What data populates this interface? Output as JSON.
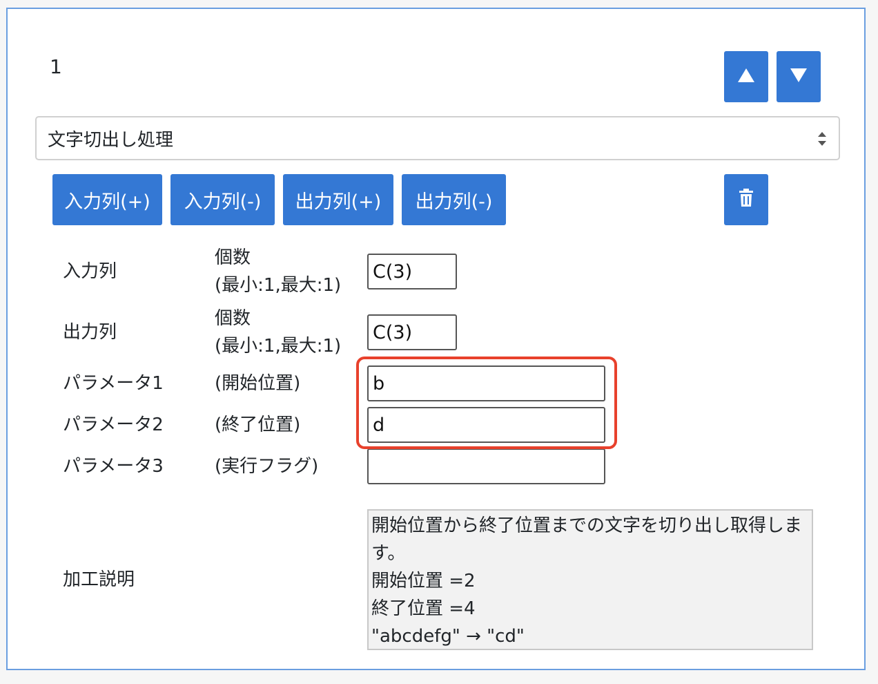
{
  "step": {
    "number": "1"
  },
  "move_buttons": {
    "up": "▲",
    "down": "▼"
  },
  "select": {
    "value": "文字切出し処理"
  },
  "toolbar": {
    "input_add": "入力列(+)",
    "input_remove": "入力列(-)",
    "output_add": "出力列(+)",
    "output_remove": "出力列(-)"
  },
  "rows": {
    "input": {
      "label": "入力列",
      "hint_line1": "個数",
      "hint_line2": "(最小:1,最大:1)",
      "value": "C(3)"
    },
    "output": {
      "label": "出力列",
      "hint_line1": "個数",
      "hint_line2": "(最小:1,最大:1)",
      "value": "C(3)"
    },
    "param1": {
      "label": "パラメータ1",
      "hint": "(開始位置)",
      "value": "b"
    },
    "param2": {
      "label": "パラメータ2",
      "hint": "(終了位置)",
      "value": "d"
    },
    "param3": {
      "label": "パラメータ3",
      "hint": "(実行フラグ)",
      "value": ""
    }
  },
  "description": {
    "label": "加工説明",
    "lines": [
      "開始位置から終了位置までの文字を切り出し取得しま",
      "す。",
      "開始位置 =2",
      "終了位置 =4",
      "\"abcdefg\" → \"cd\""
    ]
  },
  "colors": {
    "button": "#3478d4",
    "panel_border": "#6a9ee0",
    "highlight": "#e8412c"
  },
  "icons": {
    "delete": "trash-icon",
    "select_caret": "sort-caret-icon"
  }
}
